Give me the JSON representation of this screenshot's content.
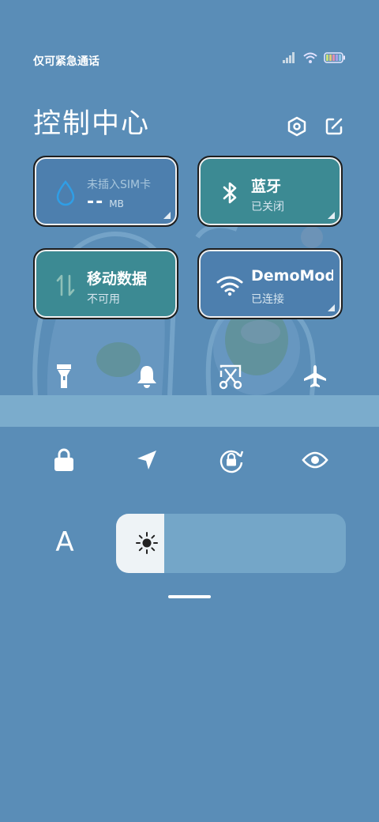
{
  "status_bar": {
    "carrier_text": "仅可紧急通话",
    "icons": [
      "signal-icon",
      "wifi-icon",
      "battery-icon"
    ]
  },
  "header": {
    "title": "控制中心",
    "settings_icon": "settings-hexagon-icon",
    "edit_icon": "edit-icon"
  },
  "tiles": {
    "data_usage": {
      "label": "未插入SIM卡",
      "value": "--",
      "unit": "MB",
      "icon": "water-drop-icon",
      "state": "off"
    },
    "bluetooth": {
      "label": "蓝牙",
      "status": "已关闭",
      "icon": "bluetooth-icon",
      "state": "on"
    },
    "mobile_data": {
      "label": "移动数据",
      "status": "不可用",
      "icon": "data-arrows-icon",
      "state": "on"
    },
    "wifi": {
      "label": "DemoMod",
      "status": "已连接",
      "icon": "wifi-icon",
      "state": "off"
    }
  },
  "quick_row_1": [
    "flashlight-icon",
    "bell-icon",
    "screenshot-scissors-icon",
    "airplane-icon"
  ],
  "quick_row_2": [
    "lock-icon",
    "location-arrow-icon",
    "rotation-lock-icon",
    "eye-icon"
  ],
  "font_size_label": "A",
  "brightness": {
    "level": 0.21,
    "icon": "sun-icon"
  },
  "colors": {
    "background": "#5a8db7",
    "tile_on": "#3c8a93",
    "tile_off": "#4d7fae",
    "brightness_fill": "#eef3f6"
  }
}
